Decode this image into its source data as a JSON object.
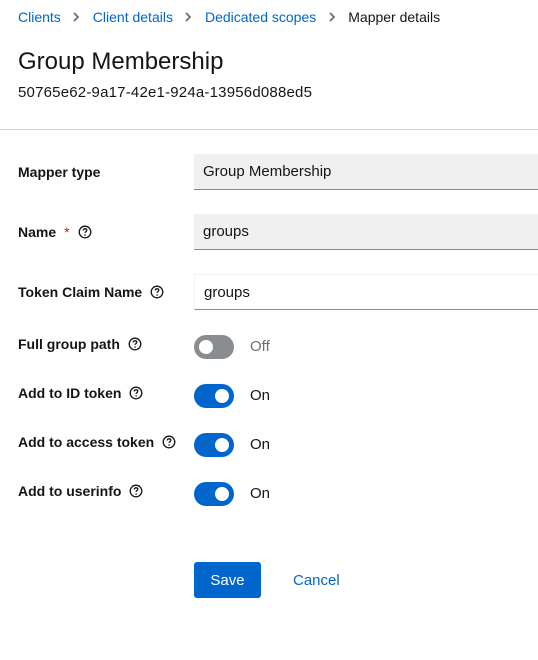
{
  "breadcrumb": {
    "items": [
      "Clients",
      "Client details",
      "Dedicated scopes"
    ],
    "current": "Mapper details"
  },
  "header": {
    "title": "Group Membership",
    "subtitle": "50765e62-9a17-42e1-924a-13956d088ed5"
  },
  "form": {
    "mapper_type": {
      "label": "Mapper type",
      "value": "Group Membership"
    },
    "name": {
      "label": "Name",
      "required_mark": "*",
      "value": "groups"
    },
    "token_claim_name": {
      "label": "Token Claim Name",
      "value": "groups"
    },
    "full_group_path": {
      "label": "Full group path",
      "state": "Off"
    },
    "add_to_id_token": {
      "label": "Add to ID token",
      "state": "On"
    },
    "add_to_access_token": {
      "label": "Add to access token",
      "state": "On"
    },
    "add_to_userinfo": {
      "label": "Add to userinfo",
      "state": "On"
    }
  },
  "actions": {
    "save_label": "Save",
    "cancel_label": "Cancel"
  },
  "colors": {
    "accent": "#0066cc",
    "required": "#c9190b",
    "switch_off": "#8a8d90",
    "readonly_bg": "#f0f0f0"
  },
  "icons": {
    "separator": "chevron-right-icon",
    "help": "help-circle-icon"
  }
}
